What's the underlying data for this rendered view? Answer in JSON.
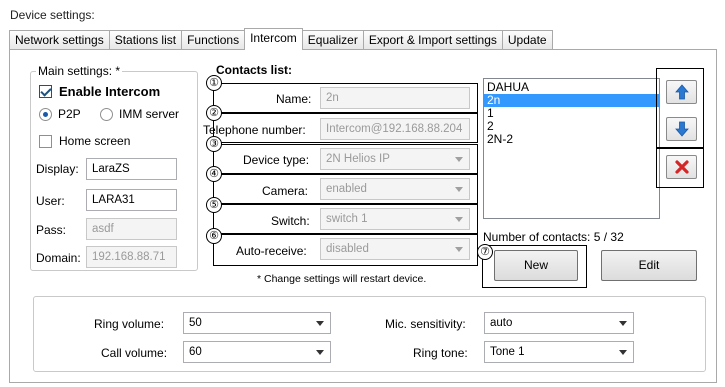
{
  "window": {
    "title": "Device settings:"
  },
  "tabs": [
    {
      "label": "Network settings"
    },
    {
      "label": "Stations list"
    },
    {
      "label": "Functions"
    },
    {
      "label": "Intercom"
    },
    {
      "label": "Equalizer"
    },
    {
      "label": "Export & Import settings"
    },
    {
      "label": "Update"
    }
  ],
  "main_settings": {
    "title": "Main settings: *",
    "enable_intercom": "Enable Intercom",
    "p2p": "P2P",
    "imm_server": "IMM server",
    "home_screen": "Home screen",
    "display_label": "Display:",
    "display_value": "LaraZS",
    "user_label": "User:",
    "user_value": "LARA31",
    "pass_label": "Pass:",
    "pass_value": "asdf",
    "domain_label": "Domain:",
    "domain_value": "192.168.88.71"
  },
  "contacts": {
    "title": "Contacts list:",
    "name_label": "Name:",
    "name_value": "2n",
    "phone_label": "Telephone number:",
    "phone_value": "Intercom@192.168.88.204",
    "device_type_label": "Device type:",
    "device_type_value": "2N Helios IP",
    "camera_label": "Camera:",
    "camera_value": "enabled",
    "switch_label": "Switch:",
    "switch_value": "switch 1",
    "auto_receive_label": "Auto-receive:",
    "auto_receive_value": "disabled",
    "note": "* Change settings will restart device.",
    "list": [
      "DAHUA",
      "2n",
      "1",
      "2",
      "2N-2"
    ],
    "count_text": "Number of contacts: 5 / 32",
    "new_button": "New",
    "edit_button": "Edit"
  },
  "markers": [
    "①",
    "②",
    "③",
    "④",
    "⑤",
    "⑥",
    "⑦"
  ],
  "audio": {
    "ring_volume_label": "Ring volume:",
    "ring_volume_value": "50",
    "call_volume_label": "Call volume:",
    "call_volume_value": "60",
    "mic_sensitivity_label": "Mic. sensitivity:",
    "mic_sensitivity_value": "auto",
    "ring_tone_label": "Ring tone:",
    "ring_tone_value": "Tone 1"
  },
  "icons": {
    "up": "arrow-up-icon",
    "down": "arrow-down-icon",
    "delete": "delete-x-icon"
  },
  "colors": {
    "selection": "#3399ff",
    "arrow_blue": "#2b78d0",
    "delete_red": "#d42626"
  }
}
